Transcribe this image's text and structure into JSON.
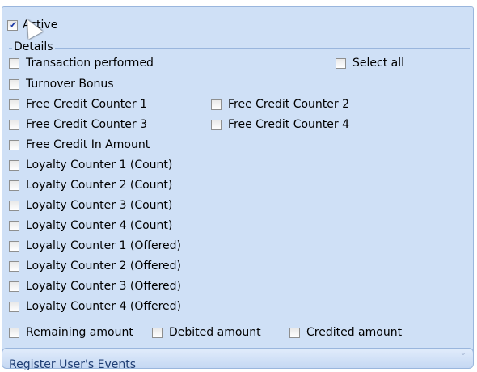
{
  "active": {
    "label": "Active",
    "checked": true
  },
  "details": {
    "group_label": "Details",
    "items": [
      {
        "label": "Transaction performed",
        "checked": false
      },
      {
        "label": "Turnover Bonus",
        "checked": false
      },
      {
        "label": "Free Credit Counter 1",
        "checked": false
      },
      {
        "label": "Free Credit Counter 2",
        "checked": false
      },
      {
        "label": "Free Credit Counter 3",
        "checked": false
      },
      {
        "label": "Free Credit Counter 4",
        "checked": false
      },
      {
        "label": "Free Credit In Amount",
        "checked": false
      },
      {
        "label": "Loyalty Counter 1 (Count)",
        "checked": false
      },
      {
        "label": "Loyalty Counter 2 (Count)",
        "checked": false
      },
      {
        "label": "Loyalty Counter 3 (Count)",
        "checked": false
      },
      {
        "label": "Loyalty Counter 4 (Count)",
        "checked": false
      },
      {
        "label": "Loyalty Counter 1 (Offered)",
        "checked": false
      },
      {
        "label": "Loyalty Counter 2 (Offered)",
        "checked": false
      },
      {
        "label": "Loyalty Counter 3 (Offered)",
        "checked": false
      },
      {
        "label": "Loyalty Counter 4 (Offered)",
        "checked": false
      },
      {
        "label": "Remaining amount",
        "checked": false
      },
      {
        "label": "Debited amount",
        "checked": false
      },
      {
        "label": "Credited amount",
        "checked": false
      }
    ],
    "select_all": {
      "label": "Select all",
      "checked": false
    }
  },
  "footer": {
    "label": "Register User's Events",
    "icon": "chevron-icon"
  }
}
